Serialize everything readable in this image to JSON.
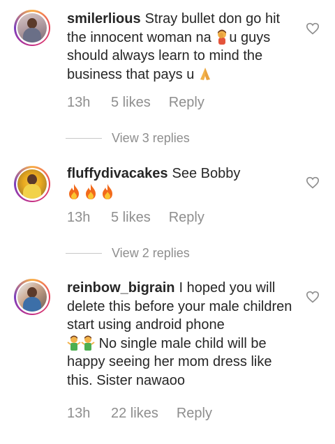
{
  "comments": [
    {
      "username": "smilerlious",
      "text_a": "Stray bullet don go hit the innocent woman na",
      "text_b": "u guys should always learn to mind the business that pays u",
      "time": "13h",
      "likes": "5 likes",
      "reply_label": "Reply",
      "view_replies": "View 3 replies"
    },
    {
      "username": "fluffydivacakes",
      "text_a": "See Bobby",
      "emojis": "fire fire fire",
      "time": "13h",
      "likes": "5 likes",
      "reply_label": "Reply",
      "view_replies": "View 2 replies"
    },
    {
      "username": "reinbow_bigrain",
      "text_a": "I hoped you will delete this before your male children start using android phone",
      "text_b": "No single male child will be happy seeing her mom dress like this. Sister nawaoo",
      "time": "13h",
      "likes": "22 likes",
      "reply_label": "Reply"
    }
  ],
  "icons": {
    "like": "heart-outline-icon",
    "facepalm": "person-facepalming-emoji",
    "pray": "folded-hands-emoji",
    "fire": "fire-emoji",
    "shrug": "person-shrugging-emoji"
  },
  "colors": {
    "text": "#262626",
    "muted": "#8e8e8e",
    "divider": "#c7c7c7"
  }
}
